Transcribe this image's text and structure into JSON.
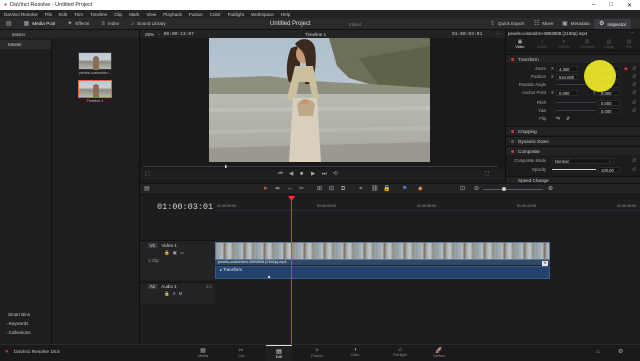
{
  "window": {
    "title": "DaVinci Resolve - Untitled Project"
  },
  "menu": [
    "DaVinci Resolve",
    "File",
    "Edit",
    "Trim",
    "Timeline",
    "Clip",
    "Mark",
    "View",
    "Playback",
    "Fusion",
    "Color",
    "Fairlight",
    "Workspace",
    "Help"
  ],
  "toolbar": {
    "media_pool": "Media Pool",
    "effects": "Effects",
    "edit_index": "Index",
    "sound_library": "Sound Library",
    "project_title": "Untitled Project",
    "edited": "Edited",
    "quick_export": "Quick Export",
    "mixer": "Mixer",
    "metadata": "Metadata",
    "inspector": "Inspector"
  },
  "media_pool": {
    "master_label": "Master",
    "master_col": "Master",
    "clips": [
      {
        "name": "pexels-costombro..."
      },
      {
        "name": "Timeline 1"
      }
    ],
    "smart_bins": "Smart Bins",
    "keywords": "Keywords",
    "collections": "Collections"
  },
  "viewer": {
    "zoom": "25%",
    "source_tc": "00:00:13:07",
    "timeline_name": "Timeline 1",
    "tc": "01:00:03:01"
  },
  "inspector": {
    "clip_name": "pexels-costombro-9892808 (2160p).mp4",
    "tabs": [
      "Video",
      "Audio",
      "Effects",
      "Transition",
      "Image",
      "File"
    ],
    "transform_title": "Transform",
    "rows": [
      {
        "label": "Zoom",
        "x_key": "X",
        "x": "4.360",
        "y_key": "Y",
        "y": "4.360"
      },
      {
        "label": "Position",
        "x_key": "X",
        "x": "534.000",
        "y_key": "Y",
        "y": "0.000"
      },
      {
        "label": "Rotation Angle",
        "value": "0.000"
      },
      {
        "label": "Anchor Point",
        "x_key": "X",
        "x": "0.000",
        "y_key": "Y",
        "y": "0.000"
      },
      {
        "label": "Pitch",
        "value": "0.000"
      },
      {
        "label": "Yaw",
        "value": "0.000"
      },
      {
        "label": "Flip"
      }
    ],
    "cropping": "Cropping",
    "dynamic_zoom": "Dynamic Zoom",
    "composite": "Composite",
    "composite_mode_label": "Composite Mode",
    "composite_mode": "Normal",
    "opacity_label": "Opacity",
    "opacity": "100.00",
    "speed_change": "Speed Change"
  },
  "timeline": {
    "timecode": "01:00:03:01",
    "ruler": [
      "01:00:00:00",
      "01:00:04:00",
      "01:00:08:00",
      "01:00:12:00",
      "01:00:16:00"
    ],
    "v1": {
      "tag": "V1",
      "name": "Video 1",
      "clips": "1 Clip"
    },
    "a1": {
      "tag": "A1",
      "name": "Audio 1",
      "ch": "2.0"
    },
    "clip_label": "pexels-costombro-9892808 (2160p).mp4",
    "fx_label": "Transform"
  },
  "bottom": {
    "app": "DaVinci Resolve 18.5",
    "pages": [
      "Media",
      "Cut",
      "Edit",
      "Fusion",
      "Color",
      "Fairlight",
      "Deliver"
    ]
  }
}
